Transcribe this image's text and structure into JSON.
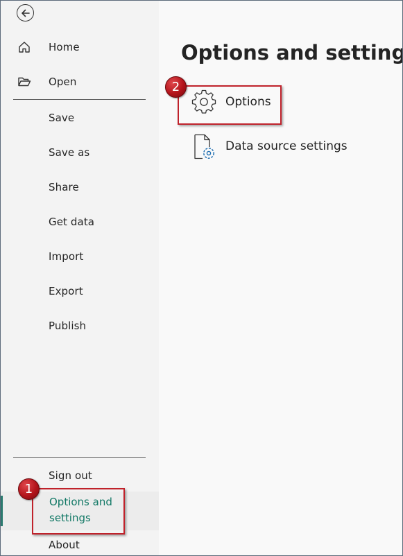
{
  "sidebar": {
    "items": [
      {
        "label": "Home",
        "icon": "home-icon"
      },
      {
        "label": "Open",
        "icon": "folder-open-icon"
      },
      {
        "label": "Save"
      },
      {
        "label": "Save as"
      },
      {
        "label": "Share"
      },
      {
        "label": "Get data"
      },
      {
        "label": "Import"
      },
      {
        "label": "Export"
      },
      {
        "label": "Publish"
      },
      {
        "label": "Sign out"
      },
      {
        "label": "Options and settings",
        "selected": true
      },
      {
        "label": "About"
      }
    ]
  },
  "main": {
    "title": "Options and settings",
    "options": [
      {
        "label": "Options",
        "icon": "gear-icon"
      },
      {
        "label": "Data source settings",
        "icon": "document-gear-icon"
      }
    ]
  },
  "annotations": {
    "step1": "1",
    "step2": "2"
  },
  "colors": {
    "sidebar_bg": "#f3f3f3",
    "main_bg": "#f9f9f9",
    "selected_text": "#117865",
    "selected_bar": "#2b7a6f",
    "highlight_red": "#c0222b",
    "icon_blue": "#1f6fb2"
  }
}
